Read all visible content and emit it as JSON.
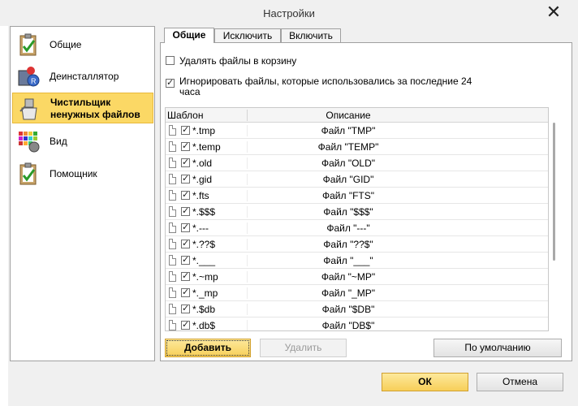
{
  "window": {
    "title": "Настройки"
  },
  "sidebar": {
    "items": [
      {
        "label": "Общие",
        "icon": "clipboard-check-icon",
        "selected": false
      },
      {
        "label": "Деинсталлятор",
        "icon": "uninstall-icon",
        "selected": false
      },
      {
        "label": "Чистильщик ненужных файлов",
        "icon": "cleaner-icon",
        "selected": true
      },
      {
        "label": "Вид",
        "icon": "view-palette-icon",
        "selected": false
      },
      {
        "label": "Помощник",
        "icon": "assistant-check-icon",
        "selected": false
      }
    ]
  },
  "tabs": [
    {
      "label": "Общие",
      "active": true
    },
    {
      "label": "Исключить",
      "active": false
    },
    {
      "label": "Включить",
      "active": false
    }
  ],
  "options": {
    "recycle_bin": {
      "label": "Удалять файлы в корзину",
      "checked": false
    },
    "ignore_recent": {
      "label_line1": "Игнорировать файлы, которые использовались за последние 24",
      "label_line2": "часа",
      "checked": true
    }
  },
  "list": {
    "columns": {
      "pattern": "Шаблон",
      "description": "Описание"
    },
    "rows": [
      {
        "pattern": "*.tmp",
        "description": "Файл \"TMP\"",
        "checked": true
      },
      {
        "pattern": "*.temp",
        "description": "Файл \"TEMP\"",
        "checked": true
      },
      {
        "pattern": "*.old",
        "description": "Файл \"OLD\"",
        "checked": true
      },
      {
        "pattern": "*.gid",
        "description": "Файл \"GID\"",
        "checked": true
      },
      {
        "pattern": "*.fts",
        "description": "Файл \"FTS\"",
        "checked": true
      },
      {
        "pattern": "*.$$$",
        "description": "Файл \"$$$\"",
        "checked": true
      },
      {
        "pattern": "*.---",
        "description": "Файл \"---\"",
        "checked": true
      },
      {
        "pattern": "*.??$",
        "description": "Файл \"??$\"",
        "checked": true
      },
      {
        "pattern": "*.___",
        "description": "Файл \"___\"",
        "checked": true
      },
      {
        "pattern": "*.~mp",
        "description": "Файл \"~MP\"",
        "checked": true
      },
      {
        "pattern": "*._mp",
        "description": "Файл \"_MP\"",
        "checked": true
      },
      {
        "pattern": "*.$db",
        "description": "Файл \"$DB\"",
        "checked": true
      },
      {
        "pattern": "*.db$",
        "description": "Файл \"DB$\"",
        "checked": true
      }
    ]
  },
  "buttons": {
    "add": "Добавить",
    "delete": "Удалить",
    "default": "По умолчанию",
    "ok": "ОК",
    "cancel": "Отмена"
  },
  "colors": {
    "selection": "#fbd865",
    "primary_button": "#f7cf59"
  }
}
